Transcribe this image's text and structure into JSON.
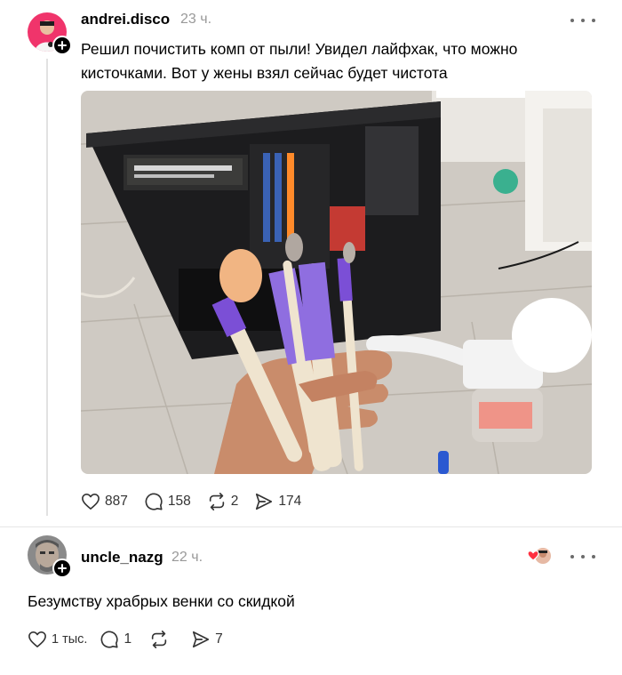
{
  "post": {
    "username": "andrei.disco",
    "time": "23 ч.",
    "text_line1": "Решил почистить комп от пыли! Увидел лайфхак, что можно",
    "text_line2": "кисточками. Вот у жены взял сейчас будет чистота",
    "likes": "887",
    "comments": "158",
    "reposts": "2",
    "shares": "174"
  },
  "reply": {
    "username": "uncle_nazg",
    "time": "22 ч.",
    "text": "Безумству храбрых венки со скидкой",
    "likes": "1 тыс.",
    "comments": "1",
    "reposts": "",
    "shares": "7"
  },
  "icons": {
    "like": "heart-icon",
    "comment": "speech-bubble-icon",
    "repost": "repost-icon",
    "share": "send-icon",
    "more": "more-dots-icon",
    "follow": "plus-icon"
  },
  "colors": {
    "text": "#000000",
    "muted": "#999999",
    "icon": "#333333",
    "brush_purple": "#7b4fd6",
    "like_red": "#ff3040"
  }
}
